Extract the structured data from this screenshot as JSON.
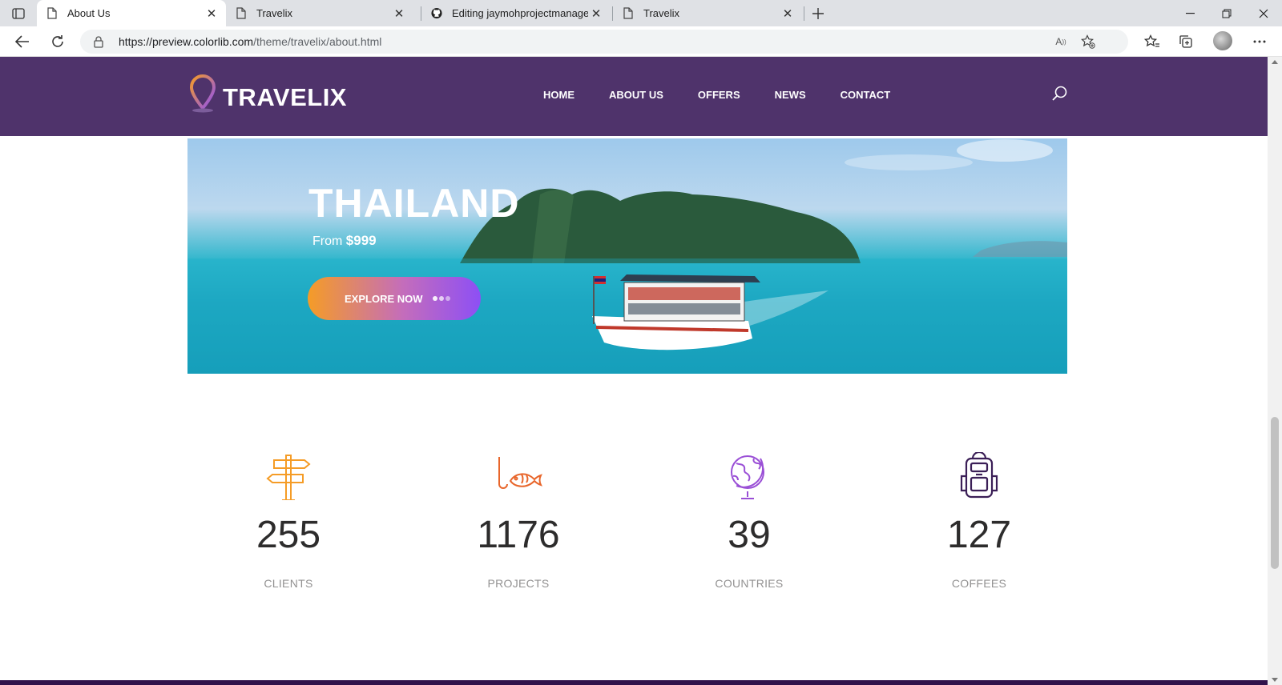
{
  "browser": {
    "tabs": [
      {
        "title": "About Us",
        "active": true,
        "icon": "page-icon"
      },
      {
        "title": "Travelix",
        "active": false,
        "icon": "page-icon"
      },
      {
        "title": "Editing jaymohprojectmanageme",
        "active": false,
        "icon": "github-icon"
      },
      {
        "title": "Travelix",
        "active": false,
        "icon": "page-icon"
      }
    ],
    "url_host": "https://preview.colorlib.com",
    "url_path": "/theme/travelix/about.html"
  },
  "site": {
    "logo_text": "TRAVELIX",
    "nav": [
      "HOME",
      "ABOUT US",
      "OFFERS",
      "NEWS",
      "CONTACT"
    ],
    "colors": {
      "header": "#4f336b",
      "accent_orange": "#f59c26",
      "accent_purple": "#8d4ff5"
    }
  },
  "hero": {
    "title": "THAILAND",
    "price_prefix": "From",
    "price": "$999",
    "button_label": "EXPLORE NOW"
  },
  "stats": [
    {
      "number": "255",
      "label": "CLIENTS",
      "icon": "signpost-icon",
      "color": "#f59c26"
    },
    {
      "number": "1176",
      "label": "PROJECTS",
      "icon": "fishing-icon",
      "color": "#e8662b"
    },
    {
      "number": "39",
      "label": "COUNTRIES",
      "icon": "globe-icon",
      "color": "#9a4fd6"
    },
    {
      "number": "127",
      "label": "COFFEES",
      "icon": "backpack-icon",
      "color": "#3b1f57"
    }
  ]
}
